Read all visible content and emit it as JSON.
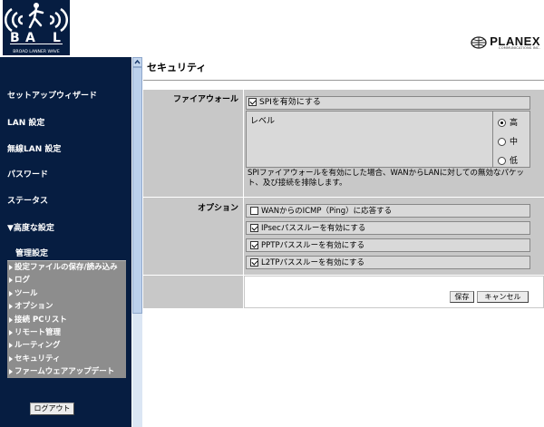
{
  "header": {
    "logo_text": "BROAD LANNER WAVE",
    "brand_name": "PLANEX",
    "brand_sub": "COMMUNICATIONS INC."
  },
  "sidebar": {
    "items": [
      {
        "label": "セットアップウィザード"
      },
      {
        "label": "LAN 設定"
      },
      {
        "label": "無線LAN 設定"
      },
      {
        "label": "パスワード"
      },
      {
        "label": "ステータス"
      },
      {
        "label": "▼高度な設定"
      }
    ],
    "section_title": "管理設定",
    "submenu": [
      {
        "label": "設定ファイルの保存/読み込み"
      },
      {
        "label": "ログ"
      },
      {
        "label": "ツール"
      },
      {
        "label": "オプション"
      },
      {
        "label": "接続 PCリスト"
      },
      {
        "label": "リモート管理"
      },
      {
        "label": "ルーティング"
      },
      {
        "label": "セキュリティ"
      },
      {
        "label": "ファームウェアアップデート"
      }
    ],
    "logout_label": "ログアウト"
  },
  "main": {
    "title": "セキュリティ",
    "firewall": {
      "label": "ファイアウォール",
      "spi_label": "SPIを有効にする",
      "spi_checked": true,
      "level_label": "レベル",
      "levels": [
        {
          "label": "高",
          "selected": true
        },
        {
          "label": "中",
          "selected": false
        },
        {
          "label": "低",
          "selected": false
        }
      ],
      "note": "SPIファイアウォールを有効にした場合、WANからLANに対しての無効なパケット、及び接続を排除します。"
    },
    "options": {
      "label": "オプション",
      "items": [
        {
          "label": "WANからのICMP（Ping）に応答する",
          "checked": false
        },
        {
          "label": "IPsecパススルーを有効にする",
          "checked": true
        },
        {
          "label": "PPTPパススルーを有効にする",
          "checked": true
        },
        {
          "label": "L2TPパススルーを有効にする",
          "checked": true
        }
      ]
    },
    "buttons": {
      "save_label": "保存",
      "cancel_label": "キャンセル"
    }
  },
  "colors": {
    "sidebar_bg": "#061d41",
    "submenu_bg": "#8d8d8d",
    "panel_bg": "#c8c8c8",
    "inner_bg": "#d9d9d9"
  }
}
